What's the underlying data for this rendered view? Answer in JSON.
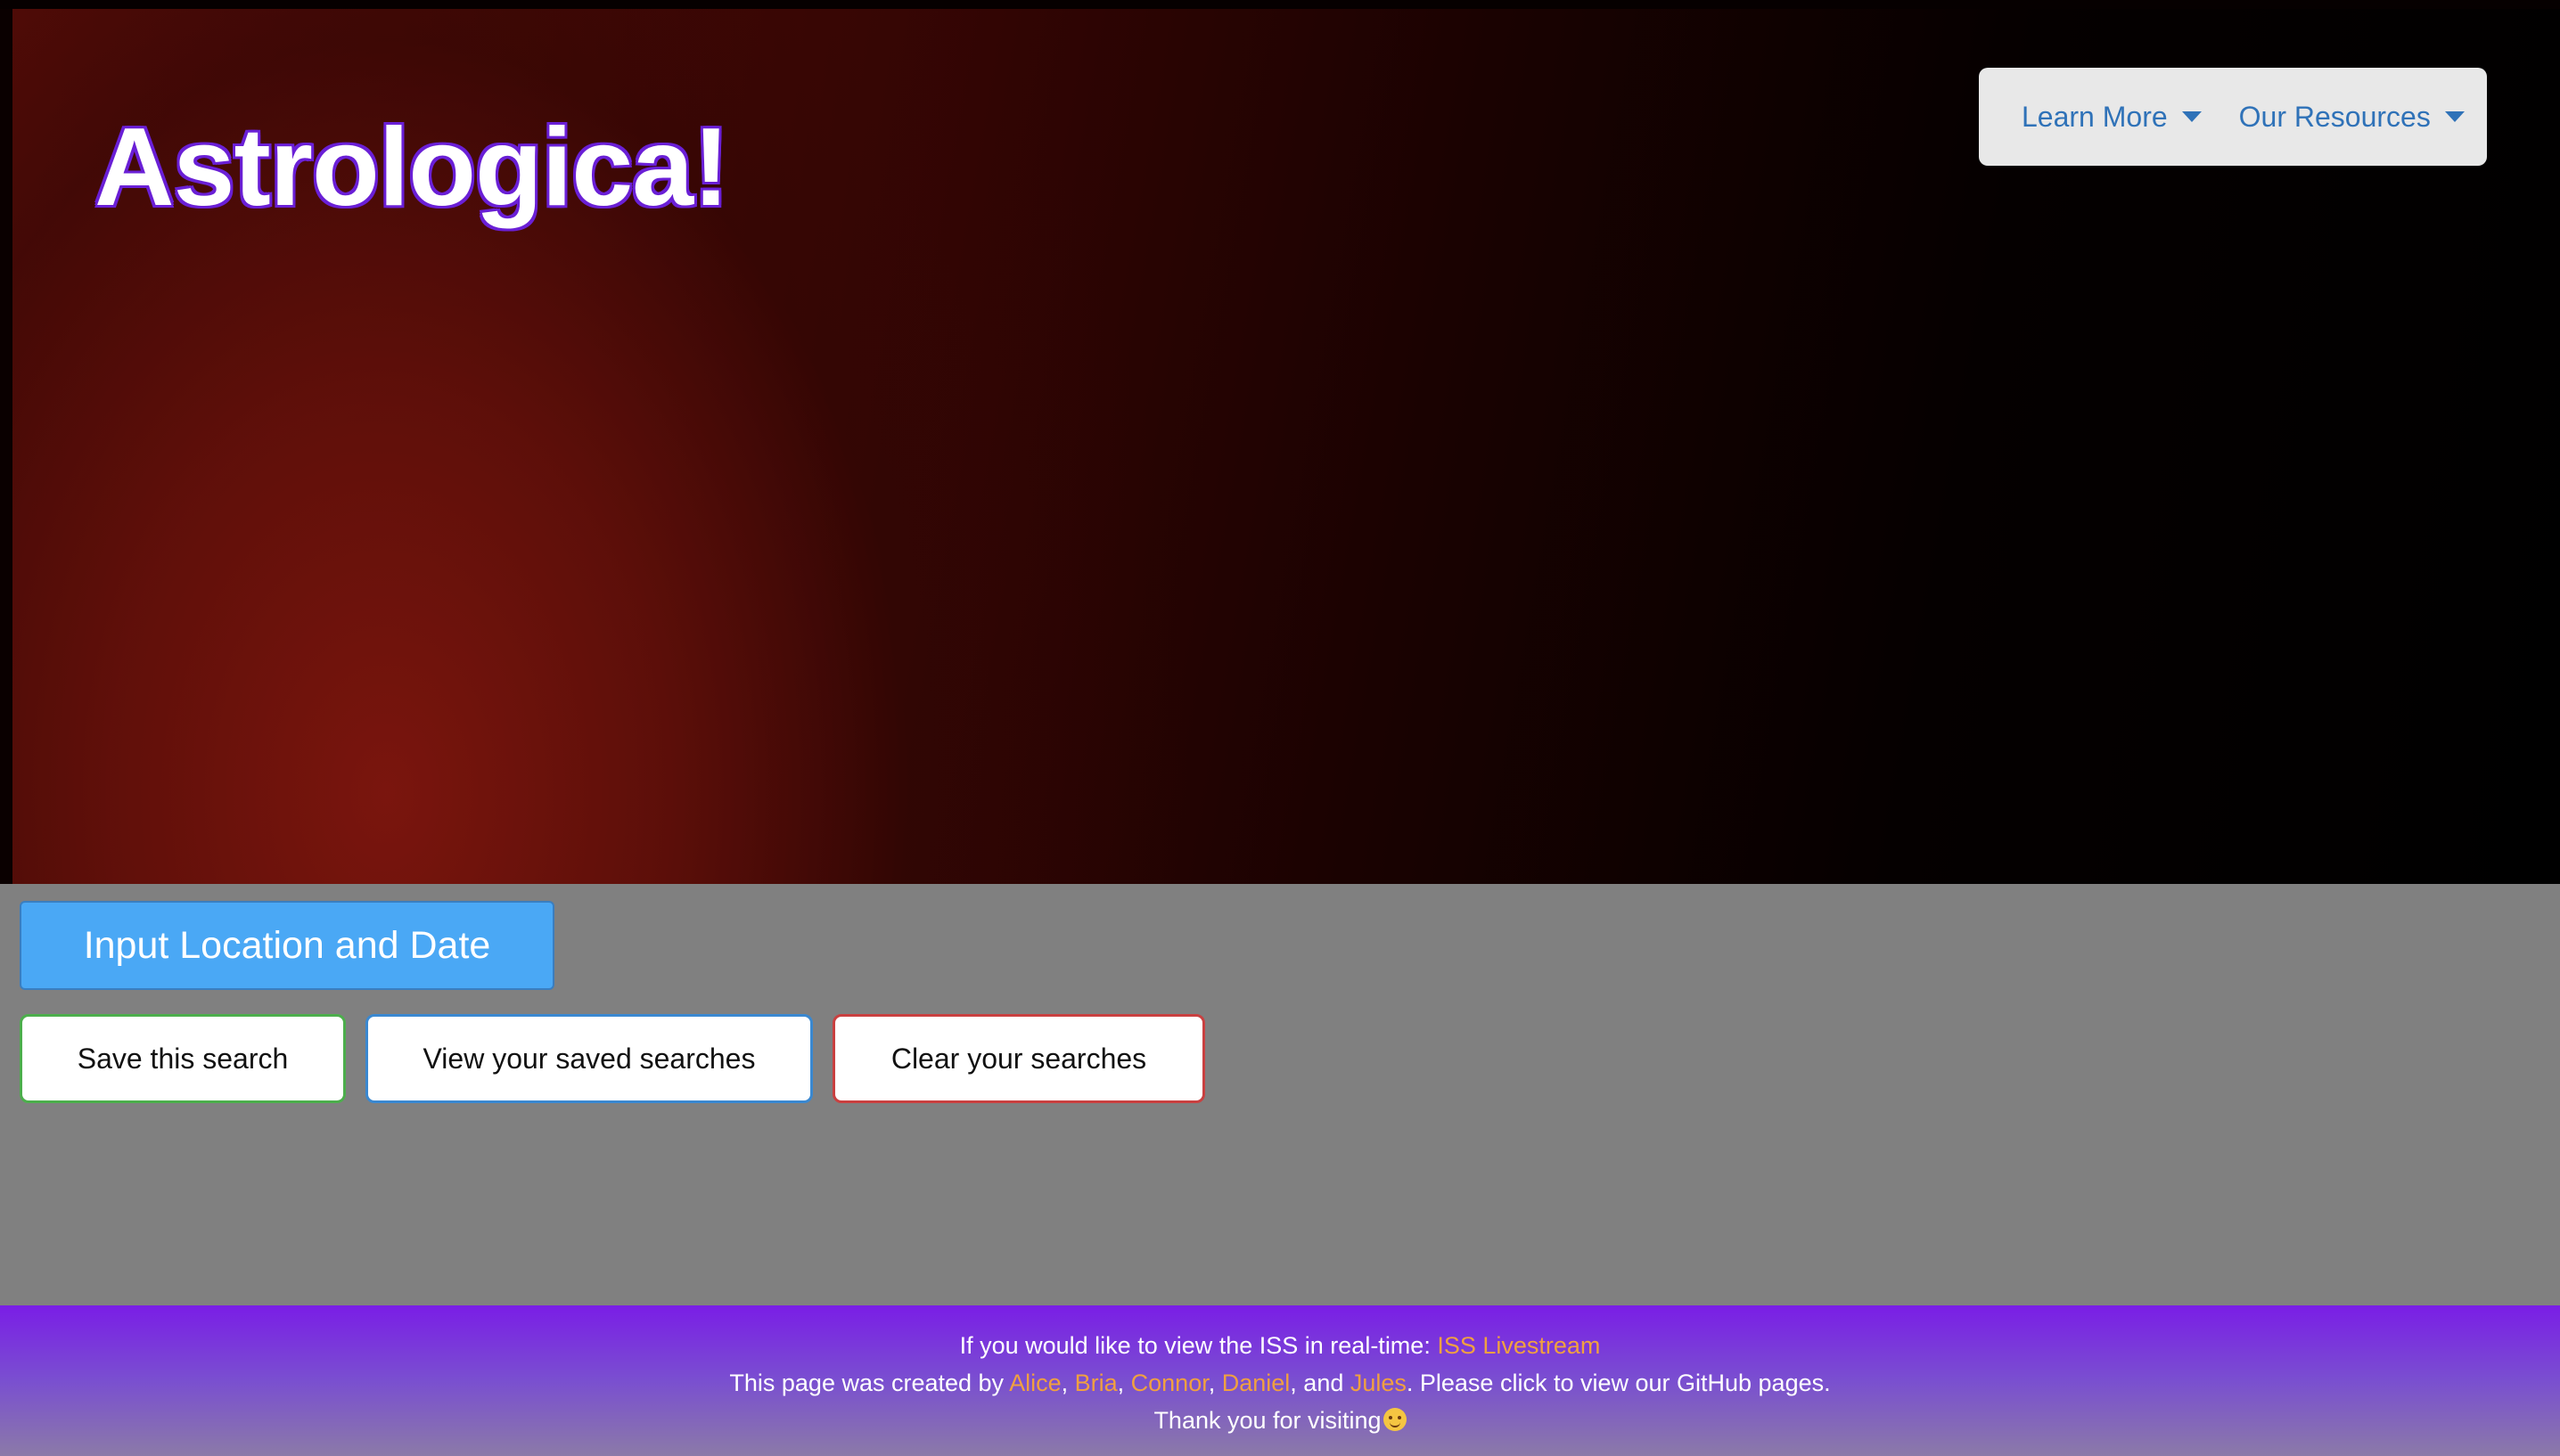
{
  "header": {
    "title": "Astrologica!",
    "nav": [
      {
        "label": "Learn More",
        "icon": "caret-down-icon"
      },
      {
        "label": "Our Resources",
        "icon": "caret-down-icon"
      }
    ]
  },
  "main": {
    "primary_button": "Input Location and Date",
    "actions": {
      "save": "Save this search",
      "view": "View your saved searches",
      "clear": "Clear your searches"
    }
  },
  "footer": {
    "line1_text": "If you would like to view the ISS in real-time: ",
    "line1_link": "ISS Livestream",
    "line2_prefix": "This page was created by ",
    "creators": [
      "Alice",
      "Bria",
      "Connor",
      "Daniel",
      "Jules"
    ],
    "sep": ", ",
    "and_text": ", and ",
    "line2_suffix": ". Please click to view our GitHub pages.",
    "line3_text": "Thank you for visiting",
    "line3_icon": "smiling-face-icon"
  },
  "colors": {
    "accent_blue": "#4aa8f5",
    "link_orange": "#f0a040",
    "footer_purple": "#7a1ee6",
    "save_border": "#4cae4c",
    "view_border": "#3a88d0",
    "clear_border": "#c94040"
  }
}
